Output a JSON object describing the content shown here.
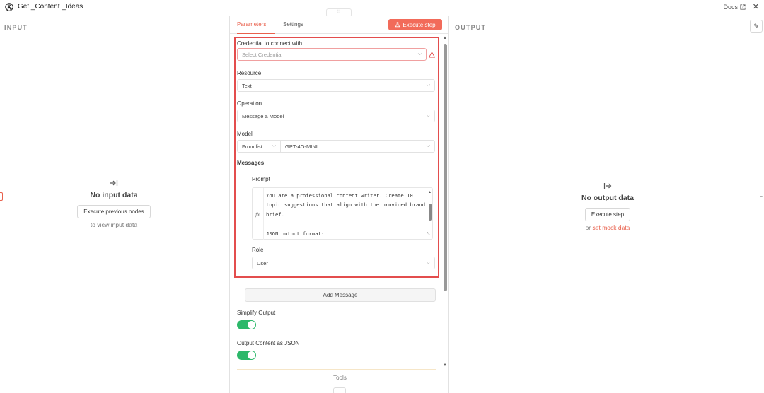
{
  "window": {
    "title": "Get _Content _Ideas",
    "docs_label": "Docs",
    "close_symbol": "✕"
  },
  "input_panel": {
    "label": "INPUT",
    "empty_title": "No input data",
    "button_label": "Execute previous nodes",
    "sub_text": "to view input data"
  },
  "output_panel": {
    "label": "OUTPUT",
    "empty_title": "No output data",
    "button_label": "Execute step",
    "sub_prefix": "or ",
    "sub_link": "set mock data"
  },
  "tabs": [
    {
      "label": "Parameters",
      "active": true
    },
    {
      "label": "Settings",
      "active": false
    }
  ],
  "execute_step_label": "Execute step",
  "form": {
    "credential": {
      "label": "Credential to connect with",
      "placeholder": "Select Credential"
    },
    "resource": {
      "label": "Resource",
      "value": "Text"
    },
    "operation": {
      "label": "Operation",
      "value": "Message a Model"
    },
    "model": {
      "label": "Model",
      "mode": "From list",
      "value": "GPT-4O-MINI"
    },
    "messages": {
      "label": "Messages",
      "prompt_label": "Prompt",
      "fx_label": "fx",
      "prompt_text": "You are a professional content writer. Create 10 topic suggestions that align with the provided brand brief.\n\nJSON output format:\n{",
      "role_label": "Role",
      "role_value": "User"
    },
    "add_message_label": "Add Message",
    "simplify_output": {
      "label": "Simplify Output",
      "enabled": true
    },
    "output_json": {
      "label": "Output Content as JSON",
      "enabled": true
    },
    "tools_label": "Tools"
  },
  "colors": {
    "accent": "#e9604c",
    "execute_button": "#f26b5a",
    "highlight_border": "#e34d4d",
    "toggle_on": "#2cb86a"
  },
  "icons": {
    "logo": "openai-logo-icon",
    "docs": "external-link-icon",
    "close": "close-icon",
    "beaker": "flask-icon",
    "warning": "warning-icon",
    "chevron": "chevron-down-icon",
    "input_arrow": "arrow-to-right-bar-icon",
    "output_arrow": "bar-arrow-right-icon",
    "edit": "pencil-icon"
  }
}
